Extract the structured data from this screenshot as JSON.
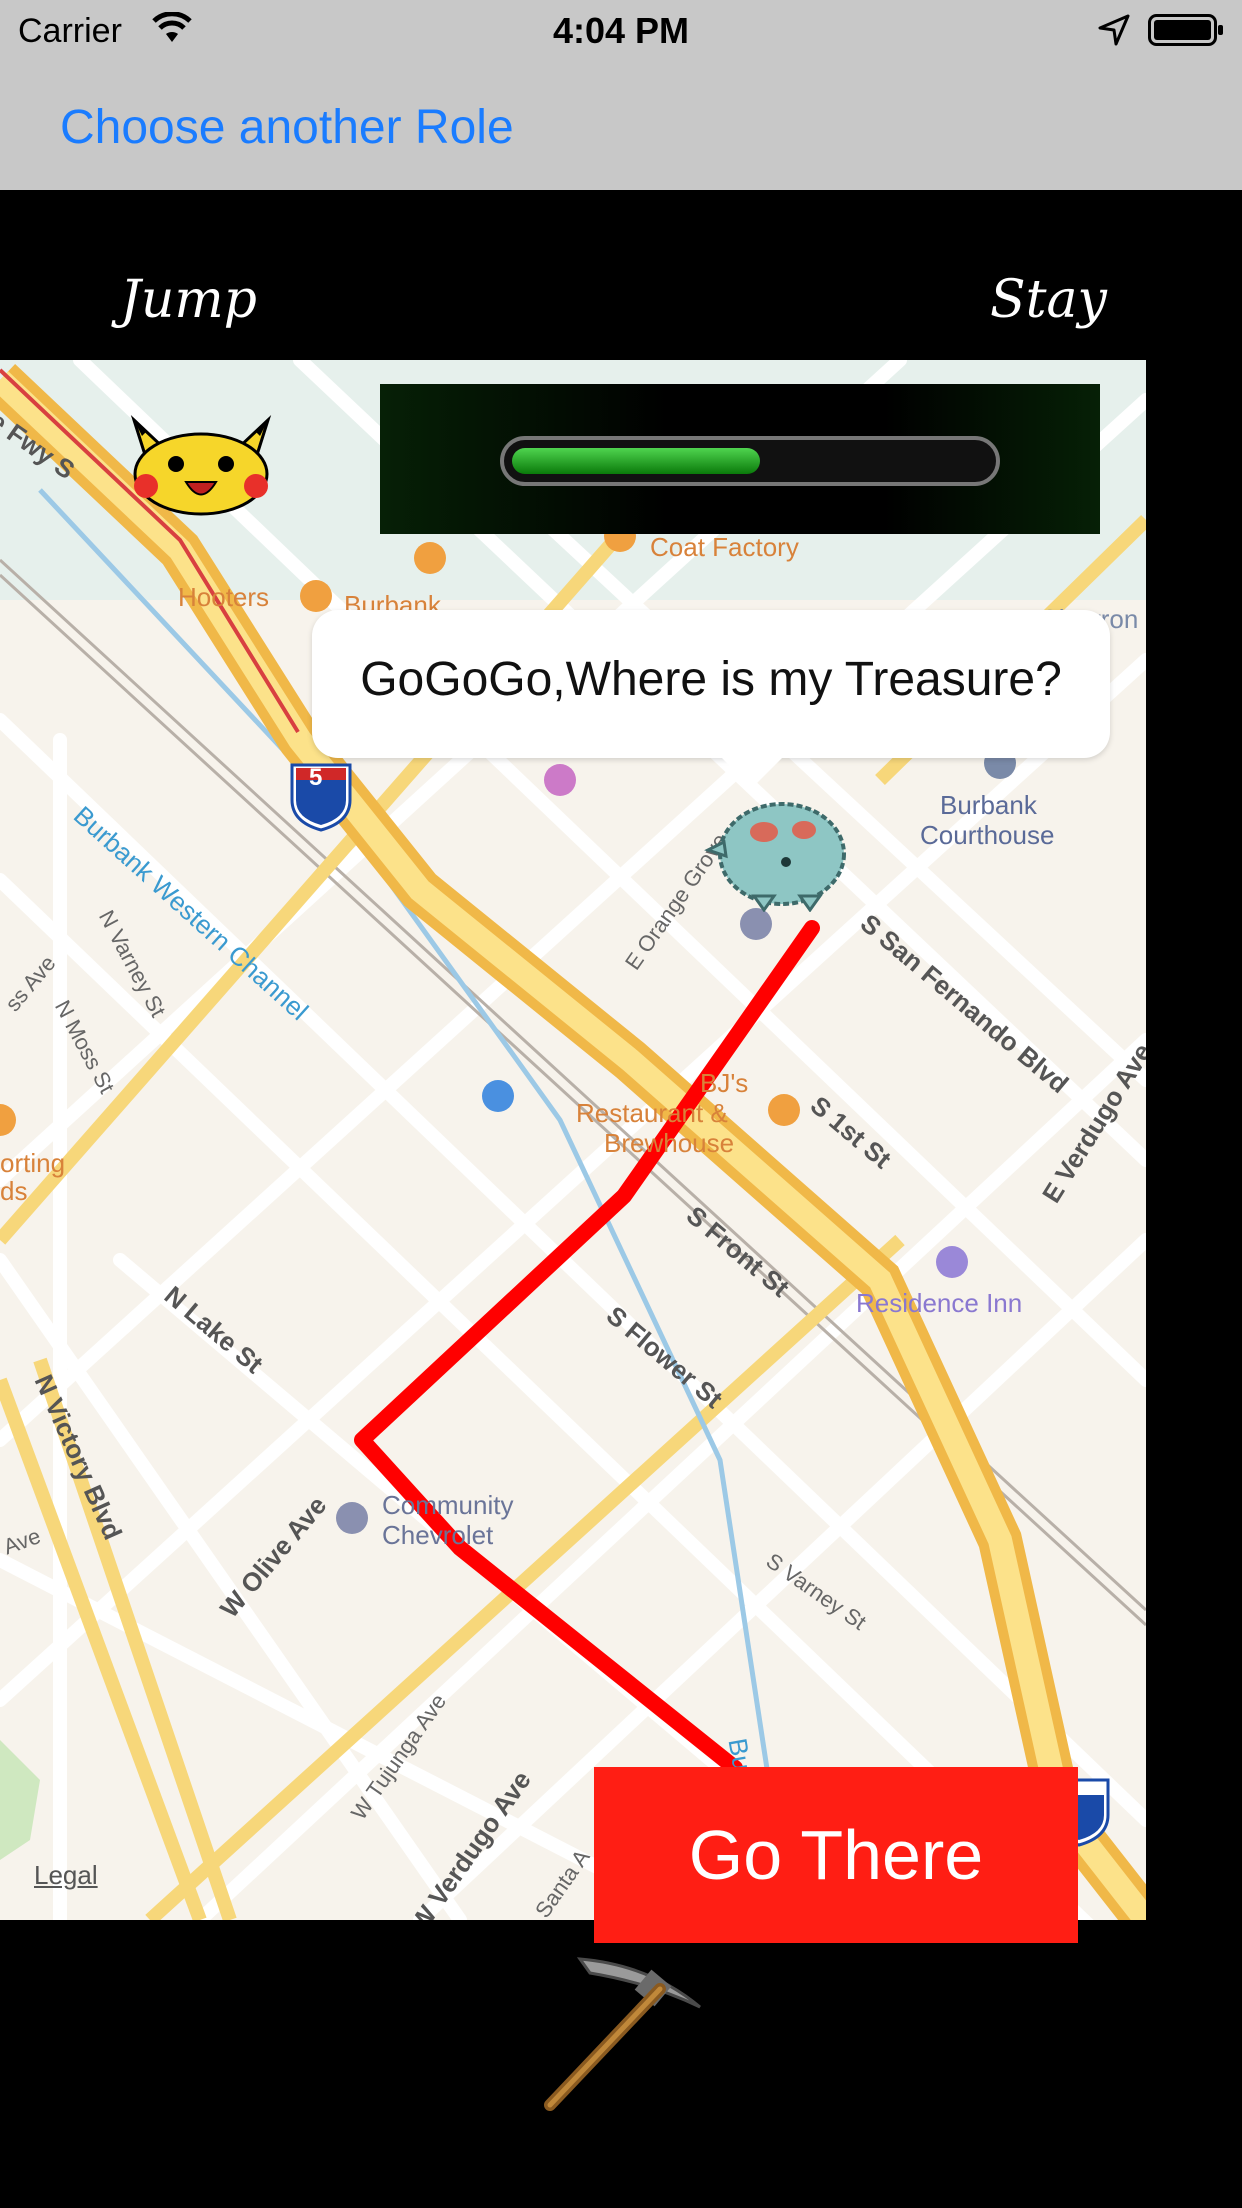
{
  "status_bar": {
    "carrier": "Carrier",
    "time": "4:04 PM"
  },
  "nav": {
    "back_label": "Choose another Role"
  },
  "controls": {
    "jump_label": "Jump",
    "stay_label": "Stay",
    "go_label": "Go There"
  },
  "progress": {
    "fraction": 0.52
  },
  "bubble": {
    "text": "GoGoGo,Where is my Treasure?"
  },
  "map": {
    "legal": "Legal",
    "shield_number": "5",
    "labels": {
      "fwy": "te Fwy S",
      "hooters": "Hooters",
      "burbank_town_center": "Burbank",
      "coat_factory": "Coat Factory",
      "chevron": "Chevron",
      "burbank_courthouse_1": "Burbank",
      "burbank_courthouse_2": "Courthouse",
      "burbank_western_channel": "Burbank Western Channel",
      "n_varney": "N Varney St",
      "n_moss": "N Moss St",
      "ss_ave": "ss Ave",
      "sporting_1": "orting",
      "sporting_2": "ds",
      "bjs_1": "BJ's",
      "bjs_2": "Restaurant &",
      "bjs_3": "Brewhouse",
      "s_san_fernando": "S San Fernando Blvd",
      "s_1st": "S 1st St",
      "e_verdugo": "E Verdugo Ave",
      "e_orange_grove": "E Orange Grove",
      "s_front": "S Front St",
      "residence_inn": "Residence Inn",
      "s_flower": "S Flower St",
      "n_lake": "N Lake St",
      "n_victory": "N Victory Blvd",
      "w_olive": "W Olive Ave",
      "community_1": "Community",
      "community_2": "Chevrolet",
      "s_varney": "S Varney St",
      "w_tujunga": "W Tujunga Ave",
      "w_verdugo": "W Verdugo Ave",
      "ave_left": "Ave",
      "santa_a": "Santa A",
      "bu": "Bu"
    }
  },
  "icons": {
    "pikachu": "pikachu-icon",
    "pokemon": "pokemon-sprite-icon",
    "pickaxe": "pickaxe-icon"
  },
  "colors": {
    "accent": "#1a7cff",
    "route": "#ff0000",
    "go_button": "#ff1e14"
  }
}
